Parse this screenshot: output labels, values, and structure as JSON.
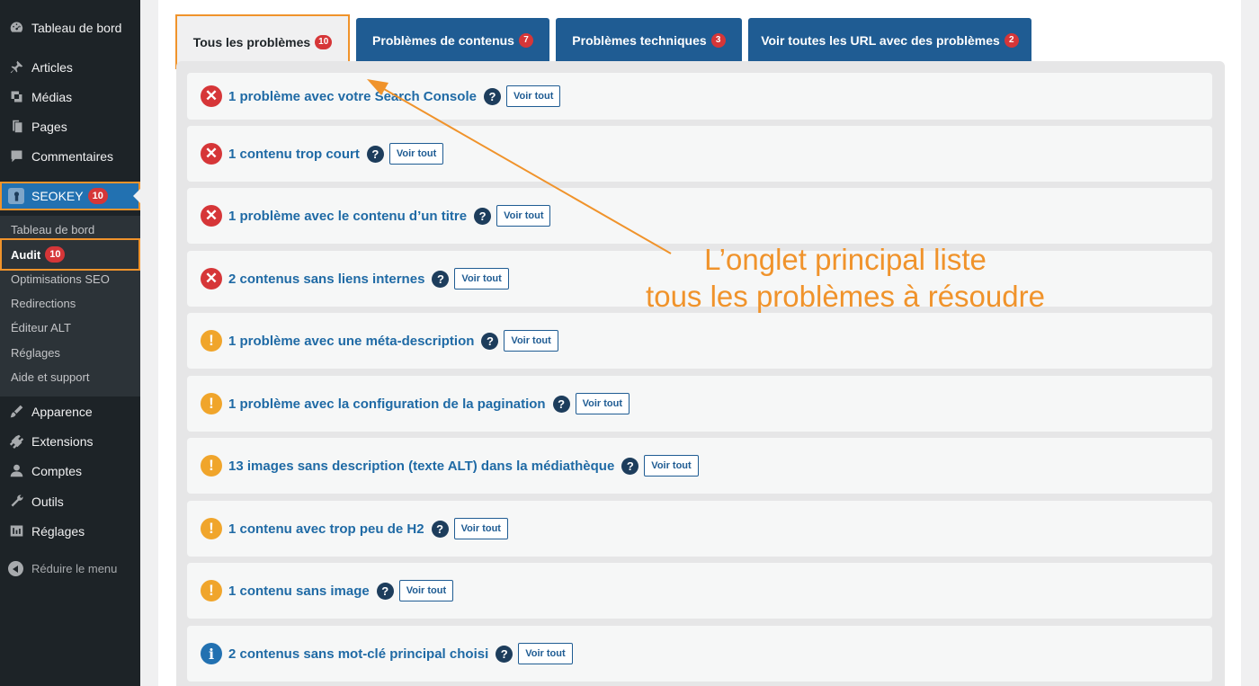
{
  "sidebar": {
    "items": [
      {
        "label": "Tableau de bord",
        "icon": "dashboard-icon"
      },
      {
        "label": "Articles",
        "icon": "pin-icon"
      },
      {
        "label": "Médias",
        "icon": "media-icon"
      },
      {
        "label": "Pages",
        "icon": "page-icon"
      },
      {
        "label": "Commentaires",
        "icon": "comment-icon"
      }
    ],
    "seokey": {
      "label": "SEOKEY",
      "badge": "10",
      "icon": "seokey-icon"
    },
    "submenu": [
      {
        "label": "Tableau de bord"
      },
      {
        "label": "Audit",
        "badge": "10"
      },
      {
        "label": "Optimisations SEO"
      },
      {
        "label": "Redirections"
      },
      {
        "label": "Éditeur ALT"
      },
      {
        "label": "Réglages"
      },
      {
        "label": "Aide et support"
      }
    ],
    "items_bottom": [
      {
        "label": "Apparence",
        "icon": "brush-icon"
      },
      {
        "label": "Extensions",
        "icon": "plugin-icon"
      },
      {
        "label": "Comptes",
        "icon": "user-icon"
      },
      {
        "label": "Outils",
        "icon": "wrench-icon"
      },
      {
        "label": "Réglages",
        "icon": "settings-icon"
      }
    ],
    "collapse_label": "Réduire le menu"
  },
  "tabs": [
    {
      "label": "Tous les problèmes",
      "badge": "10",
      "active": true
    },
    {
      "label": "Problèmes de contenus",
      "badge": "7"
    },
    {
      "label": "Problèmes techniques",
      "badge": "3"
    },
    {
      "label": "Voir toutes les URL avec des problèmes",
      "badge": "2"
    }
  ],
  "issues": [
    {
      "label": "1 problème avec votre Search Console",
      "status": "error"
    },
    {
      "label": "1 contenu trop court",
      "status": "error"
    },
    {
      "label": "1 problème avec le contenu d’un titre",
      "status": "error"
    },
    {
      "label": "2 contenus sans liens internes",
      "status": "error"
    },
    {
      "label": "1 problème avec une méta-description",
      "status": "warning"
    },
    {
      "label": "1 problème avec la configuration de la pagination",
      "status": "warning"
    },
    {
      "label": "13 images sans description (texte ALT) dans la médiathèque",
      "status": "warning"
    },
    {
      "label": "1 contenu avec trop peu de H2",
      "status": "warning"
    },
    {
      "label": "1 contenu sans image",
      "status": "warning"
    },
    {
      "label": "2 contenus sans mot-clé principal choisi",
      "status": "info"
    }
  ],
  "voir_tout_label": "Voir tout",
  "help_glyph": "?",
  "annotation": {
    "line1": "L’onglet principal liste",
    "line2": "tous les problèmes à résoudre"
  },
  "colors": {
    "accent_orange": "#f0932b",
    "wp_blue": "#2271b1",
    "tab_blue": "#1f5c93",
    "error": "#d63638",
    "warning": "#f0a52b"
  }
}
